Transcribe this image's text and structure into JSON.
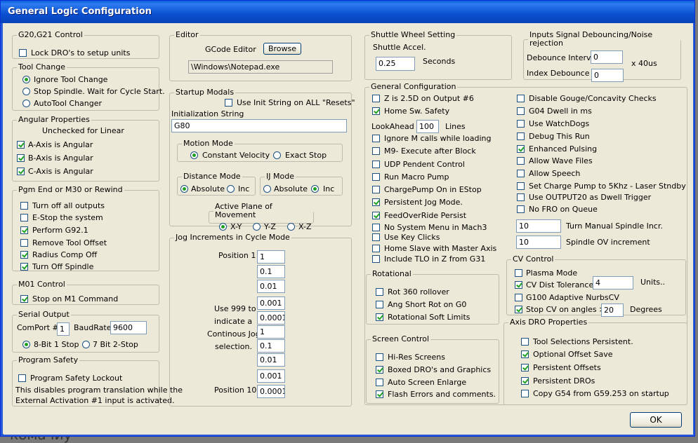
{
  "window": {
    "title": "General Logic Configuration",
    "ok_label": "OK"
  },
  "g2021": {
    "legend": "G20,G21 Control",
    "lock": "Lock DRO's to setup units"
  },
  "tool_change": {
    "legend": "Tool Change",
    "opt1": "Ignore Tool Change",
    "opt2": "Stop Spindle. Wait for Cycle Start.",
    "opt3": "AutoTool Changer"
  },
  "angular": {
    "legend": "Angular Properties",
    "note": "Unchecked for Linear",
    "a": "A-Axis is Angular",
    "b": "B-Axis is Angular",
    "c": "C-Axis is Angular"
  },
  "pgm_end": {
    "legend": "Pgm End or M30 or Rewind",
    "o1": "Turn off all outputs",
    "o2": "E-Stop the system",
    "o3": "Perform G92.1",
    "o4": "Remove Tool Offset",
    "o5": "Radius Comp Off",
    "o6": "Turn Off Spindle"
  },
  "m01": {
    "legend": "M01 Control",
    "stop": "Stop on M1 Command"
  },
  "serial": {
    "legend": "Serial Output",
    "comport_label": "ComPort #",
    "comport": "1",
    "baud_label": "BaudRate",
    "baud": "9600",
    "bit8": "8-Bit 1 Stop",
    "bit7": "7 Bit 2-Stop"
  },
  "safety": {
    "legend": "Program Safety",
    "lockout": "Program Safety Lockout",
    "desc1": "This disables program translation while the",
    "desc2": "External Activation #1 input is activated."
  },
  "editor": {
    "legend": "Editor",
    "label": "GCode Editor",
    "browse": "Browse",
    "path": "\\Windows\\Notepad.exe"
  },
  "startup": {
    "legend": "Startup Modals",
    "use_init": "Use Init String on ALL  \"Resets\"",
    "init_label": "Initialization String",
    "init_value": "G80"
  },
  "motion": {
    "legend": "Motion Mode",
    "cv": "Constant Velocity",
    "es": "Exact Stop"
  },
  "distance": {
    "legend": "Distance Mode",
    "abs": "Absolute",
    "inc": "Inc"
  },
  "ij": {
    "legend": "IJ Mode",
    "abs": "Absolute",
    "inc": "Inc"
  },
  "plane": {
    "legend": "Active Plane of Movement",
    "xy": "X-Y",
    "yz": "Y-Z",
    "xz": "X-Z"
  },
  "jog": {
    "legend": "Jog Increments in Cycle Mode",
    "pos1": "Position 1",
    "pos10": "Position 10",
    "use1": "Use 999 to",
    "use2": "indicate a",
    "use3": "Continous Jog",
    "use4": "selection.",
    "values": [
      "1",
      "0.1",
      "0.01",
      "0.001",
      "0.0001",
      "1",
      "0.1",
      "0.01",
      "0.001",
      "0.0001"
    ]
  },
  "shuttle": {
    "legend": "Shuttle Wheel Setting",
    "accel": "Shuttle Accel.",
    "value": "0.25",
    "unit": "Seconds"
  },
  "debounce": {
    "legend": "Inputs Signal Debouncing/Noise rejection",
    "interval_label": "Debounce Interval",
    "interval": "0",
    "index_label": "Index Debounce",
    "index": "0",
    "unit": "x 40us"
  },
  "general": {
    "legend": "General Configuration",
    "z25": "Z is 2.5D on Output #6",
    "home_safety": "Home Sw. Safety",
    "lookahead": "LookAhead",
    "lookahead_val": "100",
    "lines": "Lines",
    "ignore_m": "Ignore M calls while loading",
    "m9": "M9- Execute after Block",
    "udp": "UDP Pendent Control",
    "macro": "Run Macro Pump",
    "chargepump": "ChargePump On in EStop",
    "persist_jog": "Persistent Jog Mode.",
    "feedover": "FeedOverRide Persist",
    "no_sys_menu": "No System Menu in Mach3",
    "key_clicks": "Use Key Clicks",
    "home_slave": "Home Slave with Master Axis",
    "tlo": "Include TLO in Z from G31",
    "gouge": "Disable Gouge/Concavity Checks",
    "g04": "G04 Dwell in ms",
    "watchdogs": "Use WatchDogs",
    "debug": "Debug This Run",
    "pulsing": "Enhanced Pulsing",
    "wave": "Allow Wave Files",
    "speech": "Allow Speech",
    "charge5k": "Set Charge Pump to 5Khz  - Laser Stndby",
    "output20": "Use OUTPUT20 as Dwell Trigger",
    "nofro": "No FRO on Queue",
    "turn_manual_val": "10",
    "turn_manual": "Turn Manual Spindle Incr.",
    "spindle_ov_val": "10",
    "spindle_ov": "Spindle OV increment"
  },
  "rotational": {
    "legend": "Rotational",
    "rot360": "Rot 360 rollover",
    "angshort": "Ang Short Rot on G0",
    "softlim": "Rotational Soft Limits"
  },
  "cv": {
    "legend": "CV Control",
    "plasma": "Plasma Mode",
    "dist_tol": "CV Dist Tolerance",
    "dist_val": "4",
    "units": "Units..",
    "g100": "G100 Adaptive NurbsCV",
    "stop_angles": "Stop CV on angles >",
    "angle_val": "20",
    "degrees": "Degrees"
  },
  "screen": {
    "legend": "Screen Control",
    "hires": "Hi-Res Screens",
    "boxed": "Boxed DRO's and Graphics",
    "enlarge": "Auto Screen Enlarge",
    "flash": "Flash Errors and comments."
  },
  "axis_dro": {
    "legend": "Axis DRO Properties",
    "tool_sel": "Tool Selections Persistent.",
    "opt_offset": "Optional Offset Save",
    "persist_offsets": "Persistent Offsets",
    "persist_dros": "Persistent DROs",
    "copy_g54": "Copy G54 from G59.253 on startup"
  },
  "background": {
    "fragment": "комачиу"
  }
}
